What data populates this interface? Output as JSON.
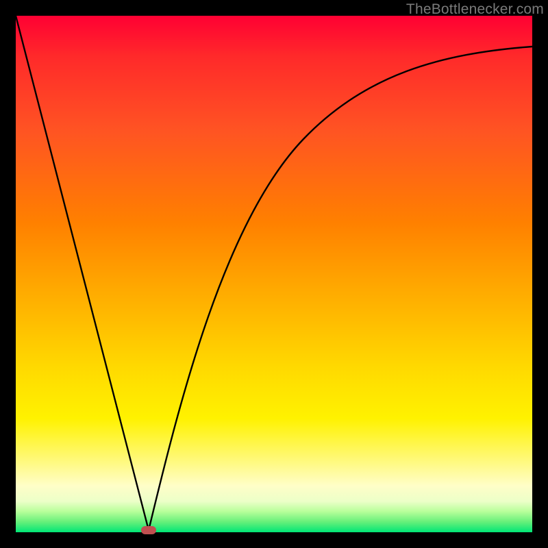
{
  "watermark": "TheBottlenecker.com",
  "marker": {
    "color": "#c05050",
    "x_frac": 0.257,
    "y_frac": 0.996
  },
  "gradient_stops": [
    {
      "pos": 0.0,
      "color": "#ff0033"
    },
    {
      "pos": 0.08,
      "color": "#ff2a2a"
    },
    {
      "pos": 0.22,
      "color": "#ff5323"
    },
    {
      "pos": 0.4,
      "color": "#ff8000"
    },
    {
      "pos": 0.56,
      "color": "#ffb300"
    },
    {
      "pos": 0.68,
      "color": "#ffd900"
    },
    {
      "pos": 0.78,
      "color": "#fff200"
    },
    {
      "pos": 0.86,
      "color": "#fff97a"
    },
    {
      "pos": 0.91,
      "color": "#fffec8"
    },
    {
      "pos": 0.94,
      "color": "#ecffc8"
    },
    {
      "pos": 0.96,
      "color": "#b7ff9a"
    },
    {
      "pos": 0.98,
      "color": "#66f07a"
    },
    {
      "pos": 1.0,
      "color": "#00e676"
    }
  ],
  "chart_data": {
    "type": "line",
    "title": "",
    "xlabel": "",
    "ylabel": "",
    "xlim": [
      0,
      1
    ],
    "ylim": [
      0,
      1
    ],
    "annotations": [
      "TheBottlenecker.com"
    ],
    "series": [
      {
        "name": "left-segment",
        "x": [
          0.0,
          0.05,
          0.1,
          0.15,
          0.2,
          0.257
        ],
        "values": [
          1.0,
          0.805,
          0.611,
          0.416,
          0.222,
          0.0
        ]
      },
      {
        "name": "right-segment",
        "x": [
          0.257,
          0.3,
          0.35,
          0.4,
          0.45,
          0.5,
          0.55,
          0.6,
          0.65,
          0.7,
          0.75,
          0.8,
          0.85,
          0.9,
          0.95,
          1.0
        ],
        "values": [
          0.0,
          0.17,
          0.345,
          0.485,
          0.59,
          0.67,
          0.732,
          0.78,
          0.818,
          0.848,
          0.872,
          0.892,
          0.908,
          0.921,
          0.932,
          0.94
        ]
      }
    ],
    "minimum_point": {
      "x": 0.257,
      "y": 0.0
    }
  }
}
